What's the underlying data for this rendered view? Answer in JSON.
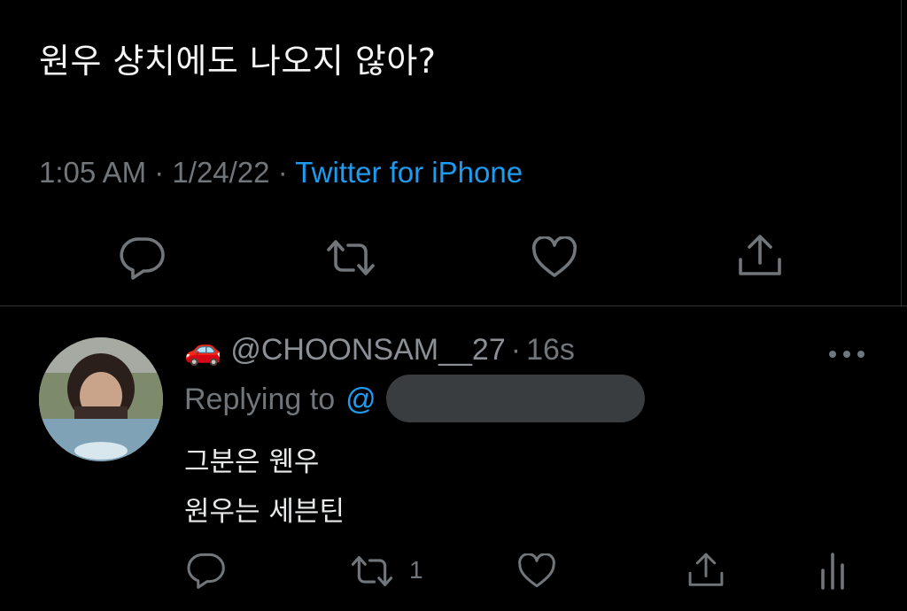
{
  "tweet": {
    "text": "원우 샹치에도 나오지 않아?",
    "time": "1:05 AM",
    "dot1": "·",
    "date": "1/24/22",
    "dot2": "·",
    "source": "Twitter for iPhone"
  },
  "reply": {
    "emoji": "🚗",
    "handle": "@CHOONSAM__27",
    "dot": "·",
    "age": "16s",
    "replying_label": "Replying to",
    "replying_at": "@",
    "lines": [
      "그분은 웬우",
      "원우는 세븐틴"
    ],
    "retweet_count": "1"
  },
  "icons": {
    "reply": "reply-icon",
    "retweet": "retweet-icon",
    "like": "heart-icon",
    "share": "share-icon",
    "more": "more-icon",
    "analytics": "analytics-icon"
  },
  "colors": {
    "background": "#000000",
    "link": "#1d9bf0",
    "muted": "#71767b",
    "text": "#e7e9ea",
    "car": "#e0333a"
  }
}
